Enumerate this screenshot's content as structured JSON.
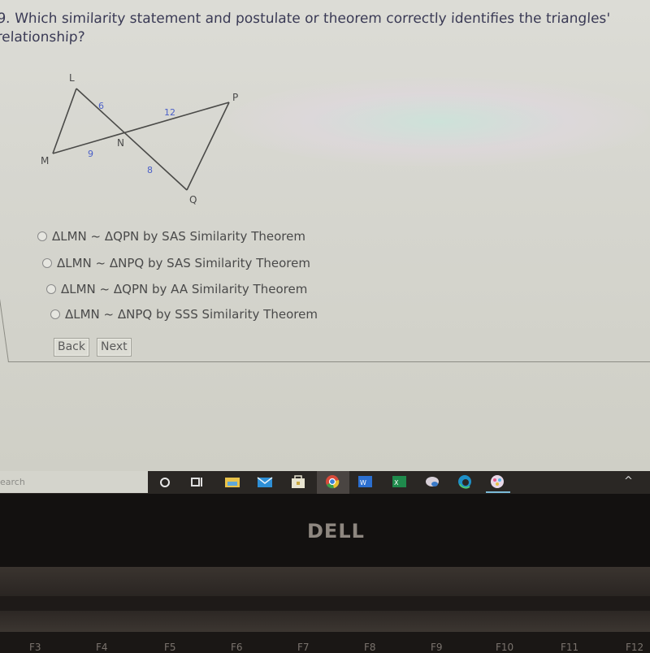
{
  "question": {
    "text": "9. Which similarity statement and postulate or theorem correctly identifies the triangles' relationship?"
  },
  "figure": {
    "vertices": {
      "L": "L",
      "M": "M",
      "N": "N",
      "P": "P",
      "Q": "Q"
    },
    "segment_labels": {
      "LN": "6",
      "MN": "9",
      "NP": "12",
      "NQ": "8"
    }
  },
  "options": [
    {
      "label": "ΔLMN ~ ΔQPN by SAS Similarity Theorem",
      "selected": false
    },
    {
      "label": "ΔLMN ~ ΔNPQ by SAS Similarity Theorem",
      "selected": false
    },
    {
      "label": "ΔLMN ~ ΔQPN by AA Similarity Theorem",
      "selected": false
    },
    {
      "label": "ΔLMN ~ ΔNPQ by SSS Similarity Theorem",
      "selected": false
    }
  ],
  "buttons": {
    "back": "Back",
    "next": "Next"
  },
  "taskbar": {
    "search_placeholder": "earch",
    "icons": [
      "cortana-icon",
      "task-view-icon",
      "file-explorer-icon",
      "mail-icon",
      "store-icon",
      "chrome-icon",
      "word-icon",
      "excel-icon",
      "app-icon",
      "edge-icon",
      "paint-icon"
    ],
    "tray_chevron": "^"
  },
  "laptop": {
    "brand": "DELL",
    "function_keys": [
      "F3",
      "F4",
      "F5",
      "F6",
      "F7",
      "F8",
      "F9",
      "F10",
      "F11",
      "F12"
    ]
  },
  "colors": {
    "question_text": "#3a3a55",
    "segment_label": "#4a5fc8",
    "taskbar": "#2a2724"
  }
}
